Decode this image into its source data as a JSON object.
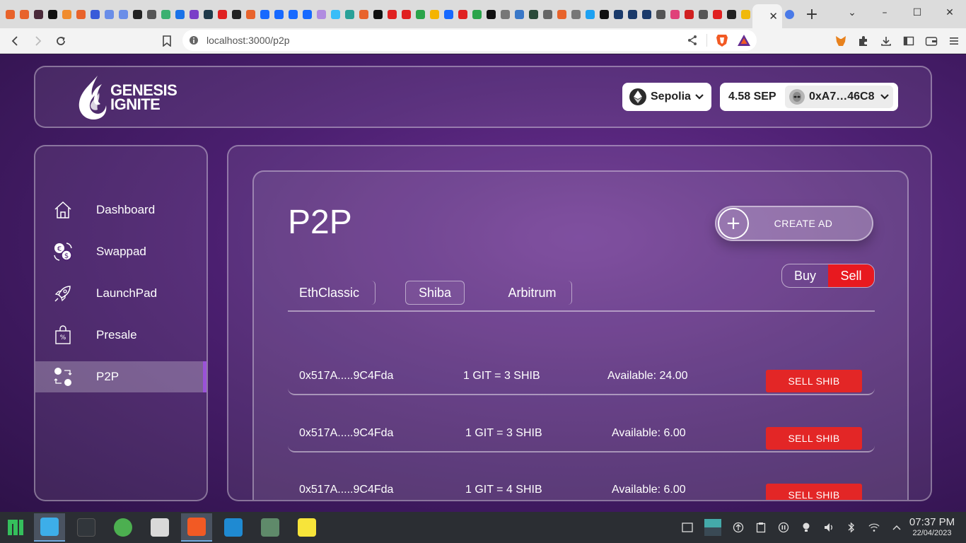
{
  "browser": {
    "url": "localhost:3000/p2p",
    "active_tab_close": "✕",
    "new_tab": "+",
    "window_controls": [
      "⌄",
      "–",
      "☐",
      "✕"
    ]
  },
  "header": {
    "logo_line1": "GENESIS",
    "logo_line2": "IGNITE",
    "network": "Sepolia",
    "balance": "4.58 SEP",
    "account": "0xA7…46C8"
  },
  "sidebar": {
    "items": [
      {
        "label": "Dashboard",
        "icon": "home-icon"
      },
      {
        "label": "Swappad",
        "icon": "coin-swap-icon"
      },
      {
        "label": "LaunchPad",
        "icon": "rocket-icon"
      },
      {
        "label": "Presale",
        "icon": "discount-bag-icon"
      },
      {
        "label": "P2P",
        "icon": "p2p-exchange-icon"
      }
    ]
  },
  "main": {
    "title": "P2P",
    "create_ad_label": "CREATE AD",
    "toggle": {
      "buy": "Buy",
      "sell": "Sell",
      "selected": "Sell"
    },
    "coin_tabs": [
      "EthClassic",
      "Shiba",
      "Arbitrum"
    ],
    "selected_coin": "Shiba",
    "offers": [
      {
        "address": "0x517A.....9C4Fda",
        "rate": "1 GIT = 3 SHIB",
        "available": "Available: 24.00",
        "action": "SELL SHIB"
      },
      {
        "address": "0x517A.....9C4Fda",
        "rate": "1 GIT = 3 SHIB",
        "available": "Available: 6.00",
        "action": "SELL SHIB"
      },
      {
        "address": "0x517A.....9C4Fda",
        "rate": "1 GIT = 4 SHIB",
        "available": "Available: 6.00",
        "action": "SELL SHIB"
      }
    ]
  },
  "taskbar": {
    "time": "07:37 PM",
    "date": "22/04/2023"
  },
  "colors": {
    "accent": "#e8191f",
    "sell_button": "#e32626",
    "background": "#4b1f70",
    "active_bar": "#9a52d8"
  }
}
